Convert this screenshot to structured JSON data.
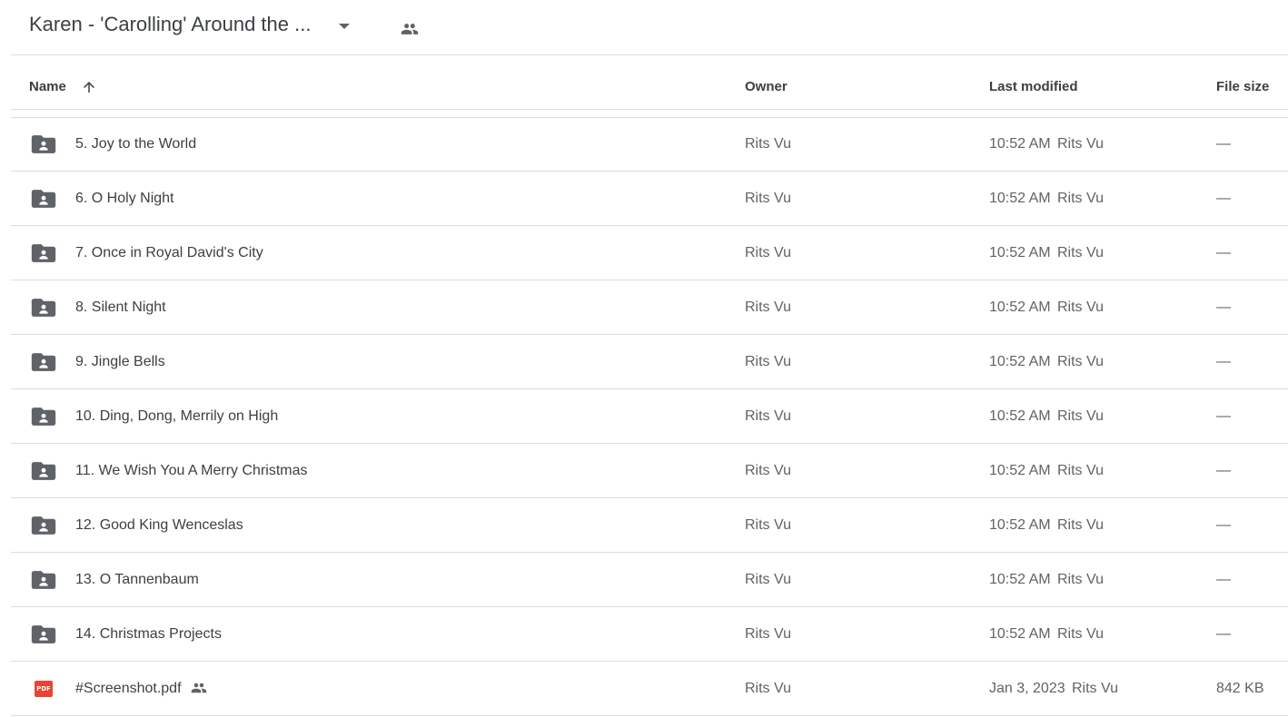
{
  "header": {
    "title": "Karen - 'Carolling' Around the ...",
    "dropdown_icon": "caret-down-icon",
    "shared_icon": "people-icon"
  },
  "columns": {
    "name": "Name",
    "owner": "Owner",
    "last_modified": "Last modified",
    "file_size": "File size",
    "sort_icon": "arrow-up-icon"
  },
  "colors": {
    "folder_icon": "#5f6368",
    "pdf_icon": "#ea4335",
    "divider": "#dadce0"
  },
  "rows": [
    {
      "name": "5. Joy to the World",
      "type": "shared-folder",
      "owner": "Rits Vu",
      "modified": "10:52 AM",
      "modified_by": "Rits Vu",
      "size": "—"
    },
    {
      "name": "6. O Holy Night",
      "type": "shared-folder",
      "owner": "Rits Vu",
      "modified": "10:52 AM",
      "modified_by": "Rits Vu",
      "size": "—"
    },
    {
      "name": "7. Once in Royal David's City",
      "type": "shared-folder",
      "owner": "Rits Vu",
      "modified": "10:52 AM",
      "modified_by": "Rits Vu",
      "size": "—"
    },
    {
      "name": "8. Silent Night",
      "type": "shared-folder",
      "owner": "Rits Vu",
      "modified": "10:52 AM",
      "modified_by": "Rits Vu",
      "size": "—"
    },
    {
      "name": "9. Jingle Bells",
      "type": "shared-folder",
      "owner": "Rits Vu",
      "modified": "10:52 AM",
      "modified_by": "Rits Vu",
      "size": "—"
    },
    {
      "name": "10. Ding, Dong, Merrily on High",
      "type": "shared-folder",
      "owner": "Rits Vu",
      "modified": "10:52 AM",
      "modified_by": "Rits Vu",
      "size": "—"
    },
    {
      "name": "11. We Wish You A Merry Christmas",
      "type": "shared-folder",
      "owner": "Rits Vu",
      "modified": "10:52 AM",
      "modified_by": "Rits Vu",
      "size": "—"
    },
    {
      "name": "12. Good King Wenceslas",
      "type": "shared-folder",
      "owner": "Rits Vu",
      "modified": "10:52 AM",
      "modified_by": "Rits Vu",
      "size": "—"
    },
    {
      "name": "13. O Tannenbaum",
      "type": "shared-folder",
      "owner": "Rits Vu",
      "modified": "10:52 AM",
      "modified_by": "Rits Vu",
      "size": "—"
    },
    {
      "name": "14. Christmas Projects",
      "type": "shared-folder",
      "owner": "Rits Vu",
      "modified": "10:52 AM",
      "modified_by": "Rits Vu",
      "size": "—"
    },
    {
      "name": "#Screenshot.pdf",
      "type": "pdf",
      "icon_label": "PDF",
      "shared": true,
      "owner": "Rits Vu",
      "modified": "Jan 3, 2023",
      "modified_by": "Rits Vu",
      "size": "842 KB"
    }
  ]
}
